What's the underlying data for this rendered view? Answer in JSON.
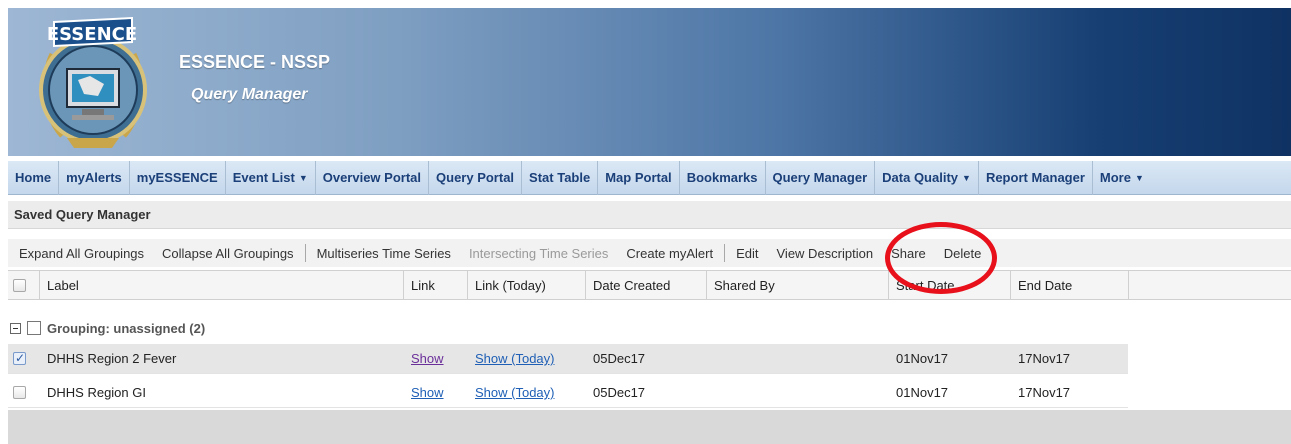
{
  "app": {
    "title": "ESSENCE - NSSP",
    "subtitle": "Query Manager",
    "logo_text": "ESSENCE"
  },
  "nav": {
    "items": [
      {
        "label": "Home",
        "dropdown": false
      },
      {
        "label": "myAlerts",
        "dropdown": false
      },
      {
        "label": "myESSENCE",
        "dropdown": false
      },
      {
        "label": "Event List",
        "dropdown": true
      },
      {
        "label": "Overview Portal",
        "dropdown": false
      },
      {
        "label": "Query Portal",
        "dropdown": false
      },
      {
        "label": "Stat Table",
        "dropdown": false
      },
      {
        "label": "Map Portal",
        "dropdown": false
      },
      {
        "label": "Bookmarks",
        "dropdown": false
      },
      {
        "label": "Query Manager",
        "dropdown": false
      },
      {
        "label": "Data Quality",
        "dropdown": true
      },
      {
        "label": "Report Manager",
        "dropdown": false
      },
      {
        "label": "More",
        "dropdown": true
      }
    ],
    "caret": "▼"
  },
  "section": {
    "title": "Saved Query Manager"
  },
  "toolbar": {
    "expand_all": "Expand All Groupings",
    "collapse_all": "Collapse All Groupings",
    "multiseries": "Multiseries Time Series",
    "intersecting": "Intersecting Time Series",
    "create_alert": "Create myAlert",
    "edit": "Edit",
    "view_description": "View Description",
    "share": "Share",
    "delete": "Delete"
  },
  "grid": {
    "columns": {
      "label": "Label",
      "link": "Link",
      "link_today": "Link (Today)",
      "date_created": "Date Created",
      "shared_by": "Shared By",
      "start_date": "Start Date",
      "end_date": "End Date"
    },
    "group": {
      "label": "Grouping: unassigned (2)"
    },
    "rows": [
      {
        "label": "DHHS Region 2 Fever",
        "link": "Show",
        "link_today": "Show (Today)",
        "date_created": "05Dec17",
        "shared_by": "",
        "start_date": "01Nov17",
        "end_date": "17Nov17",
        "checked": true
      },
      {
        "label": "DHHS Region GI",
        "link": "Show",
        "link_today": "Show (Today)",
        "date_created": "05Dec17",
        "shared_by": "",
        "start_date": "01Nov17",
        "end_date": "17Nov17",
        "checked": false
      }
    ]
  },
  "colors": {
    "nav_text": "#1b3f78",
    "link": "#1f5fb5",
    "visited_link": "#6b2f9a",
    "annotation": "#e8101b"
  }
}
